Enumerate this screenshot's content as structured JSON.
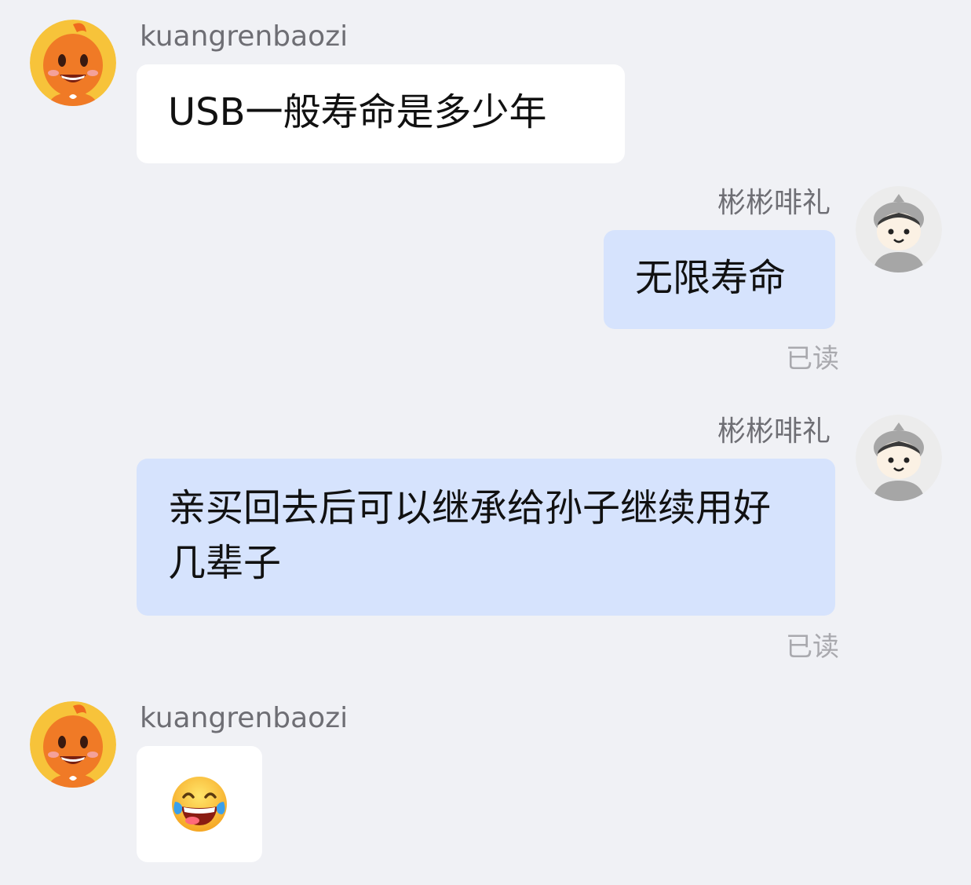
{
  "users": {
    "customer": {
      "name": "kuangrenbaozi",
      "avatar_icon": "orange-mascot-avatar-icon"
    },
    "agent": {
      "name": "彬彬啡礼",
      "avatar_icon": "helmet-boy-avatar-icon"
    }
  },
  "messages": [
    {
      "sender": "kuangrenbaozi",
      "text": "USB一般寿命是多少年"
    },
    {
      "sender": "彬彬啡礼",
      "text": "无限寿命",
      "status": "已读"
    },
    {
      "sender": "彬彬啡礼",
      "text": "亲买回去后可以继承给孙子继续用好几辈子",
      "status": "已读"
    },
    {
      "sender": "kuangrenbaozi",
      "emoji": "tears-of-joy-emoji-icon"
    }
  ],
  "colors": {
    "background": "#f0f1f5",
    "incoming_bubble": "#ffffff",
    "outgoing_bubble": "#d6e3fd",
    "name_text": "#6e6e74",
    "read_text": "#a9a9ae"
  }
}
